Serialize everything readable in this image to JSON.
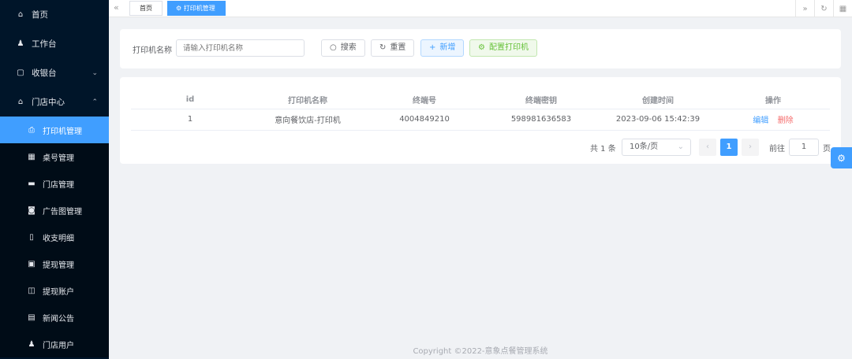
{
  "sidebar": {
    "items": [
      {
        "label": "首页",
        "icon": "home-icon"
      },
      {
        "label": "工作台",
        "icon": "bell-icon"
      },
      {
        "label": "收银台",
        "icon": "bag-icon"
      },
      {
        "label": "门店中心",
        "icon": "store-icon"
      }
    ],
    "sub_items": [
      {
        "label": "打印机管理",
        "icon": "printer-icon",
        "active": true
      },
      {
        "label": "桌号管理",
        "icon": "grid-icon"
      },
      {
        "label": "门店管理",
        "icon": "shop-icon"
      },
      {
        "label": "广告图管理",
        "icon": "camera-icon"
      },
      {
        "label": "收支明细",
        "icon": "note-icon"
      },
      {
        "label": "提现管理",
        "icon": "wallet-icon"
      },
      {
        "label": "提现账户",
        "icon": "account-icon"
      },
      {
        "label": "新闻公告",
        "icon": "news-icon"
      },
      {
        "label": "门店用户",
        "icon": "user-icon"
      }
    ]
  },
  "tags": {
    "home": "首页",
    "current": "打印机管理"
  },
  "search": {
    "label": "打印机名称",
    "placeholder": "请输入打印机名称",
    "search_btn": "搜索",
    "reset_btn": "重置",
    "add_btn": "新增",
    "config_btn": "配置打印机"
  },
  "table": {
    "headers": [
      "id",
      "打印机名称",
      "终端号",
      "终端密钥",
      "创建时间",
      "操作"
    ],
    "rows": [
      {
        "id": "1",
        "name": "意向餐饮店-打印机",
        "terminal": "4004849210",
        "key": "598981636583",
        "created": "2023-09-06 15:42:39",
        "edit": "编辑",
        "delete": "删除"
      }
    ]
  },
  "pagination": {
    "total": "共 1 条",
    "page_size": "10条/页",
    "current_page": "1",
    "goto_label": "前往",
    "goto_value": "1",
    "goto_suffix": "页"
  },
  "footer": "Copyright ©2022-意象点餐管理系统",
  "colors": {
    "primary": "#409eff",
    "sidebar": "#001529",
    "danger": "#f56c6c",
    "success": "#67c23a"
  }
}
